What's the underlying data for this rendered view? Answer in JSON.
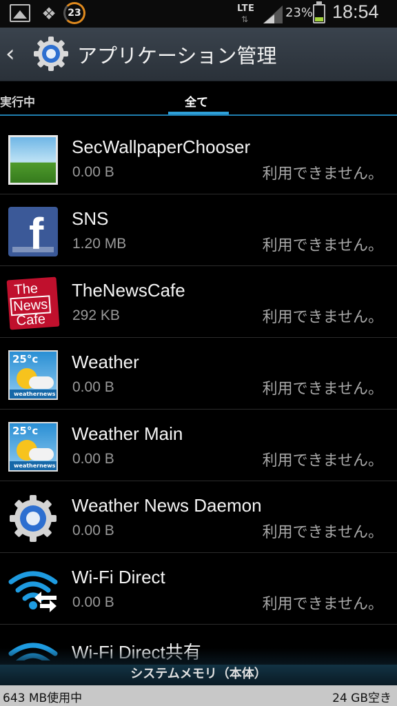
{
  "status_bar": {
    "notification_badge": "23",
    "network": "LTE",
    "battery_percent": "23%",
    "battery_level": 0.23,
    "time": "18:54"
  },
  "header": {
    "title": "アプリケーション管理"
  },
  "tabs": [
    {
      "label": "実行中"
    },
    {
      "label": "全て",
      "selected": true
    }
  ],
  "apps": [
    {
      "name": "SecWallpaperChooser",
      "size": "0.00 B",
      "status": "利用できません。",
      "icon": "wallpaper-icon"
    },
    {
      "name": "SNS",
      "size": "1.20 MB",
      "status": "利用できません。",
      "icon": "facebook-icon"
    },
    {
      "name": "TheNewsCafe",
      "size": "292 KB",
      "status": "利用できません。",
      "icon": "newscafe-icon",
      "icon_text": [
        "The",
        "News",
        "Cafe"
      ]
    },
    {
      "name": "Weather",
      "size": "0.00 B",
      "status": "利用できません。",
      "icon": "weather-icon",
      "icon_temp": "25°c",
      "icon_brand": "weathernews"
    },
    {
      "name": "Weather Main",
      "size": "0.00 B",
      "status": "利用できません。",
      "icon": "weather-icon",
      "icon_temp": "25°c",
      "icon_brand": "weathernews"
    },
    {
      "name": "Weather News Daemon",
      "size": "0.00 B",
      "status": "利用できません。",
      "icon": "gear-icon"
    },
    {
      "name": "Wi-Fi Direct",
      "size": "0.00 B",
      "status": "利用できません。",
      "icon": "wifi-direct-icon"
    },
    {
      "name": "Wi-Fi Direct共有",
      "size": "",
      "status": "",
      "icon": "wifi-direct-icon"
    }
  ],
  "footer": {
    "memory_label": "システムメモリ（本体）",
    "used": "643 MB使用中",
    "free": "24 GB空き"
  },
  "colors": {
    "accent": "#2ea0d8",
    "background": "#000000",
    "titlebar": "#323a43"
  }
}
